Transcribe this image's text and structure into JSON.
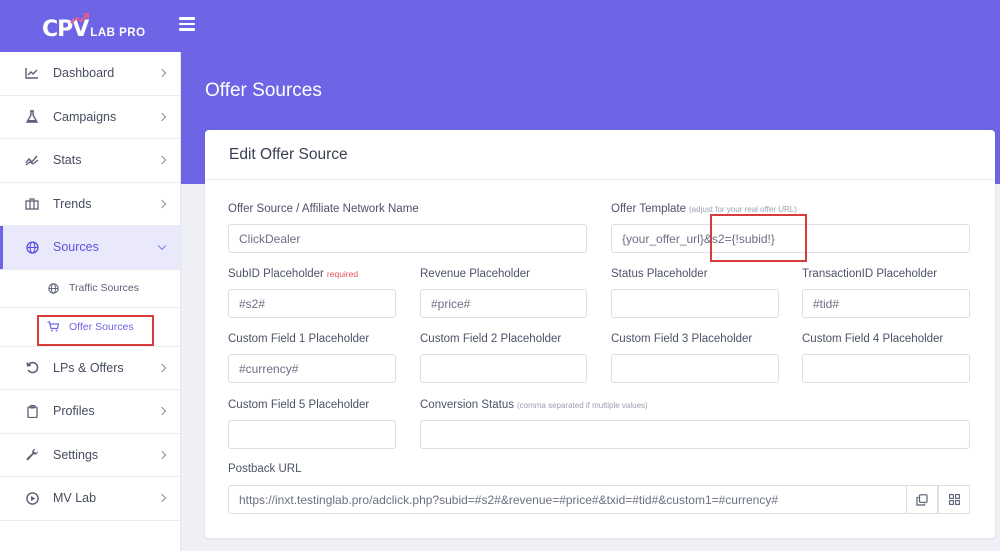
{
  "brand": {
    "mark": "CPV",
    "name": "LAB PRO"
  },
  "page": {
    "title": "Offer Sources"
  },
  "sidebar": {
    "items": [
      {
        "label": "Dashboard",
        "icon": "chart-line-icon"
      },
      {
        "label": "Campaigns",
        "icon": "flask-icon"
      },
      {
        "label": "Stats",
        "icon": "stats-icon"
      },
      {
        "label": "Trends",
        "icon": "briefcase-icon"
      },
      {
        "label": "Sources",
        "icon": "globe-icon"
      },
      {
        "label": "LPs & Offers",
        "icon": "refresh-icon"
      },
      {
        "label": "Profiles",
        "icon": "clipboard-icon"
      },
      {
        "label": "Settings",
        "icon": "wrench-icon"
      },
      {
        "label": "MV Lab",
        "icon": "play-circle-icon"
      }
    ],
    "sources_sub": [
      {
        "label": "Traffic Sources",
        "icon": "globe-icon"
      },
      {
        "label": "Offer Sources",
        "icon": "cart-icon"
      }
    ]
  },
  "form": {
    "card_title": "Edit Offer Source",
    "name": {
      "label": "Offer Source / Affiliate Network Name",
      "value": "ClickDealer"
    },
    "template": {
      "label": "Offer Template",
      "hint": "(adjust for your real offer URL)",
      "value": "{your_offer_url}&s2={!subid!}"
    },
    "subid": {
      "label": "SubID Placeholder",
      "required": "required",
      "value": "#s2#"
    },
    "revenue": {
      "label": "Revenue Placeholder",
      "value": "#price#"
    },
    "status": {
      "label": "Status Placeholder",
      "value": ""
    },
    "txid": {
      "label": "TransactionID Placeholder",
      "value": "#tid#"
    },
    "custom1": {
      "label": "Custom Field 1 Placeholder",
      "value": "#currency#"
    },
    "custom2": {
      "label": "Custom Field 2 Placeholder",
      "value": ""
    },
    "custom3": {
      "label": "Custom Field 3 Placeholder",
      "value": ""
    },
    "custom4": {
      "label": "Custom Field 4 Placeholder",
      "value": ""
    },
    "custom5": {
      "label": "Custom Field 5 Placeholder",
      "value": ""
    },
    "conversion": {
      "label": "Conversion Status",
      "hint": "(comma separated if multiple values)",
      "value": ""
    },
    "postback": {
      "label": "Postback URL",
      "value": "https://inxt.testinglab.pro/adclick.php?subid=#s2#&revenue=#price#&txid=#tid#&custom1=#currency#"
    }
  },
  "colors": {
    "accent": "#6d65e6",
    "highlight": "#d93b3b",
    "required": "#e4525a"
  }
}
